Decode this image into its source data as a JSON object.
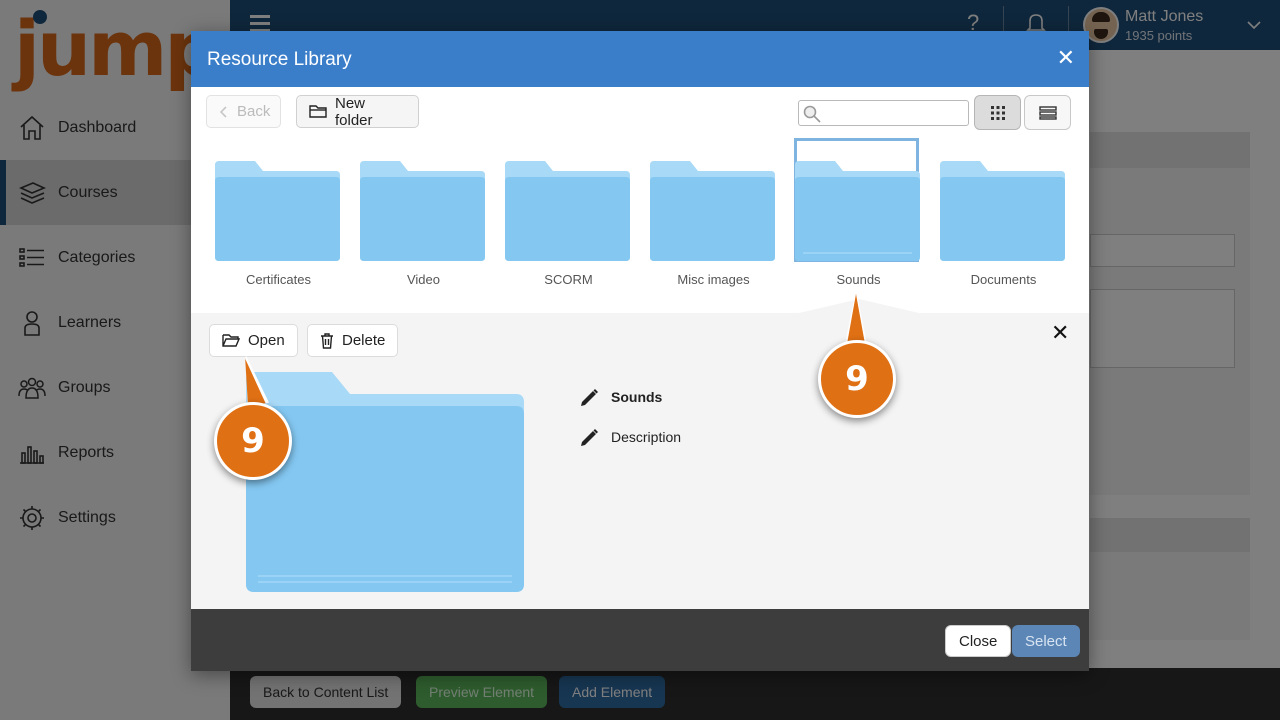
{
  "app": {
    "logo_text": "jump",
    "nav": [
      {
        "label": "Dashboard",
        "icon": "home-icon"
      },
      {
        "label": "Courses",
        "icon": "books-icon"
      },
      {
        "label": "Categories",
        "icon": "list-icon"
      },
      {
        "label": "Learners",
        "icon": "person-icon"
      },
      {
        "label": "Groups",
        "icon": "group-icon"
      },
      {
        "label": "Reports",
        "icon": "bar-chart-icon"
      },
      {
        "label": "Settings",
        "icon": "gear-icon"
      }
    ],
    "active_nav": "Courses",
    "user": {
      "name": "Matt Jones",
      "points": "1935 points"
    },
    "footer_buttons": {
      "back": "Back to Content List",
      "preview": "Preview Element",
      "add": "Add Element"
    }
  },
  "modal": {
    "title": "Resource Library",
    "toolbar": {
      "back_label": "Back",
      "new_folder_label": "New folder",
      "search_value": "",
      "search_placeholder": ""
    },
    "folders": [
      {
        "label": "Certificates",
        "selected": false
      },
      {
        "label": "Video",
        "selected": false
      },
      {
        "label": "SCORM",
        "selected": false
      },
      {
        "label": "Misc images",
        "selected": false
      },
      {
        "label": "Sounds",
        "selected": true
      },
      {
        "label": "Documents",
        "selected": false
      }
    ],
    "detail": {
      "open_label": "Open",
      "delete_label": "Delete",
      "name": "Sounds",
      "description_label": "Description"
    },
    "footer": {
      "close_label": "Close",
      "select_label": "Select"
    }
  },
  "callouts": {
    "open_step": "9",
    "folder_step": "9"
  },
  "colors": {
    "accent": "#3a7dc9",
    "brand_nav": "#1f4e79",
    "callout": "#e07014",
    "folder": "#84c8f2"
  }
}
